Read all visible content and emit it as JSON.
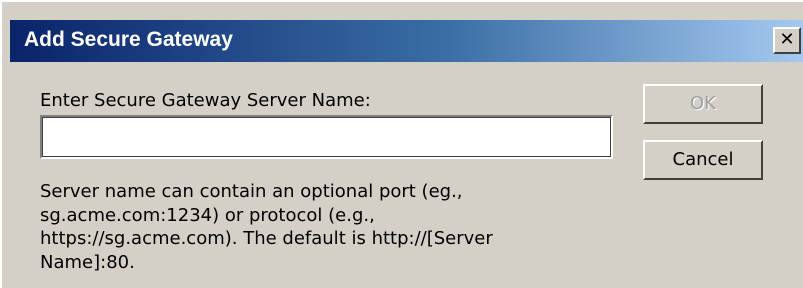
{
  "dialog": {
    "title": "Add Secure Gateway",
    "close_glyph": "✕",
    "close_icon": "close-icon",
    "prompt_label": "Enter Secure Gateway Server Name:",
    "server_name_value": "",
    "help_text": "Server name can contain an optional port (eg., sg.acme.com:1234) or protocol (e.g., https://sg.acme.com). The default is http://[Server Name]:80.",
    "ok_label": "OK",
    "ok_disabled": true,
    "cancel_label": "Cancel"
  },
  "colors": {
    "dialog_bg": "#d4d0c8",
    "title_gradient_start": "#0a246a",
    "title_gradient_end": "#a6caf0",
    "title_text": "#ffffff",
    "disabled_text": "#a0a0a0"
  }
}
